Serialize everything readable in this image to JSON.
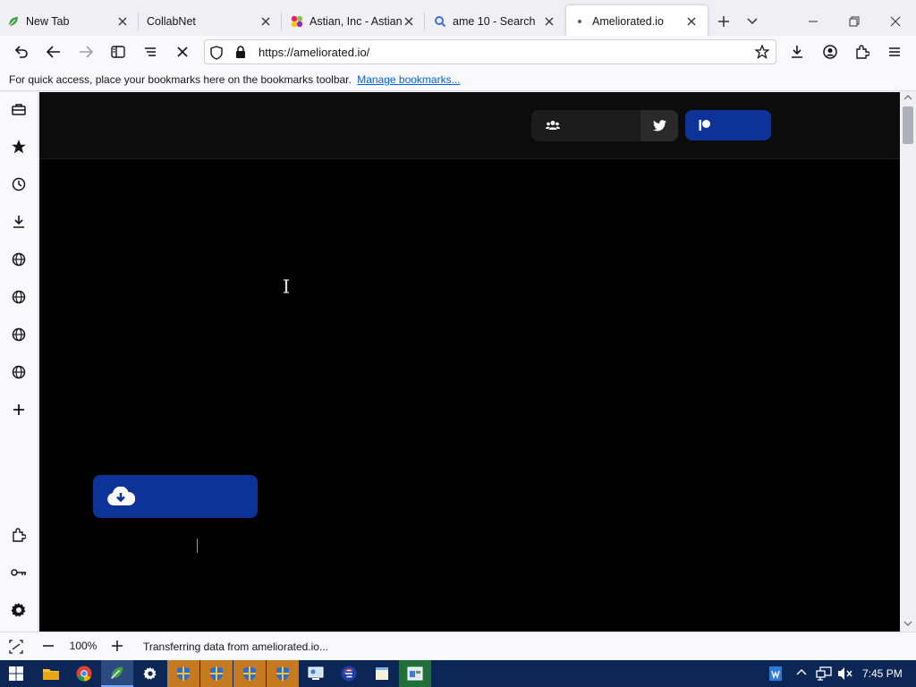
{
  "tabs": [
    {
      "title": "New Tab",
      "icon": "leaf-icon"
    },
    {
      "title": "CollabNet",
      "icon": "none"
    },
    {
      "title": "Astian, Inc - Astian Cloud",
      "icon": "astian-logo-icon"
    },
    {
      "title": "ame 10 - Search",
      "icon": "search-icon"
    },
    {
      "title": "Ameliorated.io",
      "icon": "loading-dot-icon"
    }
  ],
  "navbar": {
    "url": "https://ameliorated.io/"
  },
  "bookmarks": {
    "message": "For quick access, place your bookmarks here on the bookmarks toolbar.",
    "link": "Manage bookmarks..."
  },
  "status": {
    "zoom": "100%",
    "message": "Transferring data from ameliorated.io..."
  },
  "taskbar": {
    "time": "7:45 PM"
  },
  "colors": {
    "accent_blue": "#0d3398",
    "page_bg": "#000000",
    "taskbar": "#0c2756"
  }
}
